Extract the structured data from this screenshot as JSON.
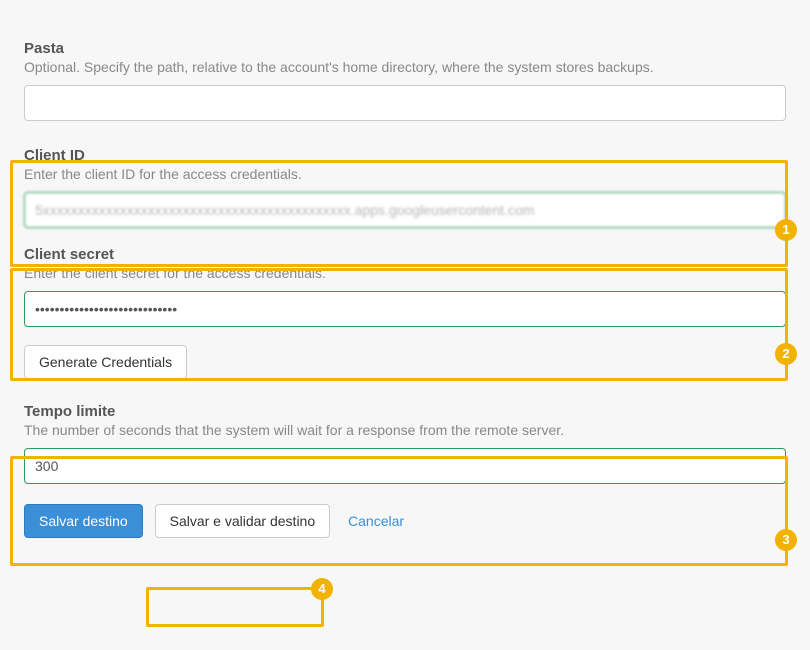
{
  "fields": {
    "pasta": {
      "label": "Pasta",
      "help": "Optional. Specify the path, relative to the account's home directory, where the system stores backups.",
      "value": ""
    },
    "client_id": {
      "label": "Client ID",
      "help": "Enter the client ID for the access credentials.",
      "value": "5xxxxxxxxxxxxxxxxxxxxxxxxxxxxxxxxxxxxxxxxxxxx.apps.googleusercontent.com"
    },
    "client_secret": {
      "label": "Client secret",
      "help": "Enter the client secret for the access credentials.",
      "value": "•••••••••••••••••••••••••••••"
    },
    "timeout": {
      "label": "Tempo limite",
      "help": "The number of seconds that the system will wait for a response from the remote server.",
      "value": "300"
    }
  },
  "buttons": {
    "generate": "Generate Credentials",
    "save": "Salvar destino",
    "save_validate": "Salvar e validar destino",
    "cancel": "Cancelar"
  },
  "callouts": {
    "n1": "1",
    "n2": "2",
    "n3": "3",
    "n4": "4"
  },
  "colors": {
    "highlight": "#f2b200",
    "primary": "#3a8fd8",
    "valid_border": "#2e9b5a"
  }
}
